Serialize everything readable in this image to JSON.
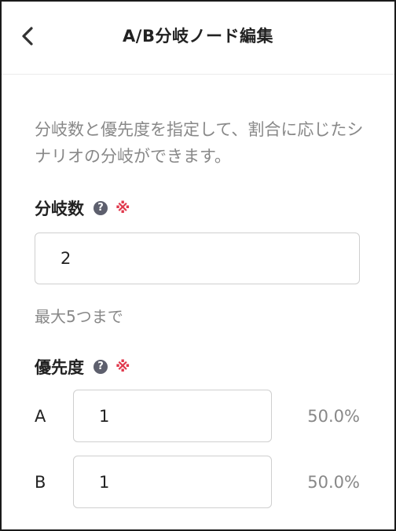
{
  "header": {
    "title": "A/B分岐ノード編集",
    "back_icon": "chevron-left-icon"
  },
  "description": "分岐数と優先度を指定して、割合に応じたシナリオの分岐ができます。",
  "branch_count": {
    "label": "分岐数",
    "help_icon": "question-circle-icon",
    "required_mark": "※",
    "value": "2",
    "hint": "最大5つまで"
  },
  "priority": {
    "label": "優先度",
    "help_icon": "question-circle-icon",
    "required_mark": "※",
    "rows": [
      {
        "name": "A",
        "value": "1",
        "percent": "50.0%"
      },
      {
        "name": "B",
        "value": "1",
        "percent": "50.0%"
      }
    ]
  },
  "colors": {
    "required": "#e0384c",
    "muted_text": "#888888",
    "help_icon_bg": "#5d5f6d",
    "input_border": "#cfcfcf"
  }
}
